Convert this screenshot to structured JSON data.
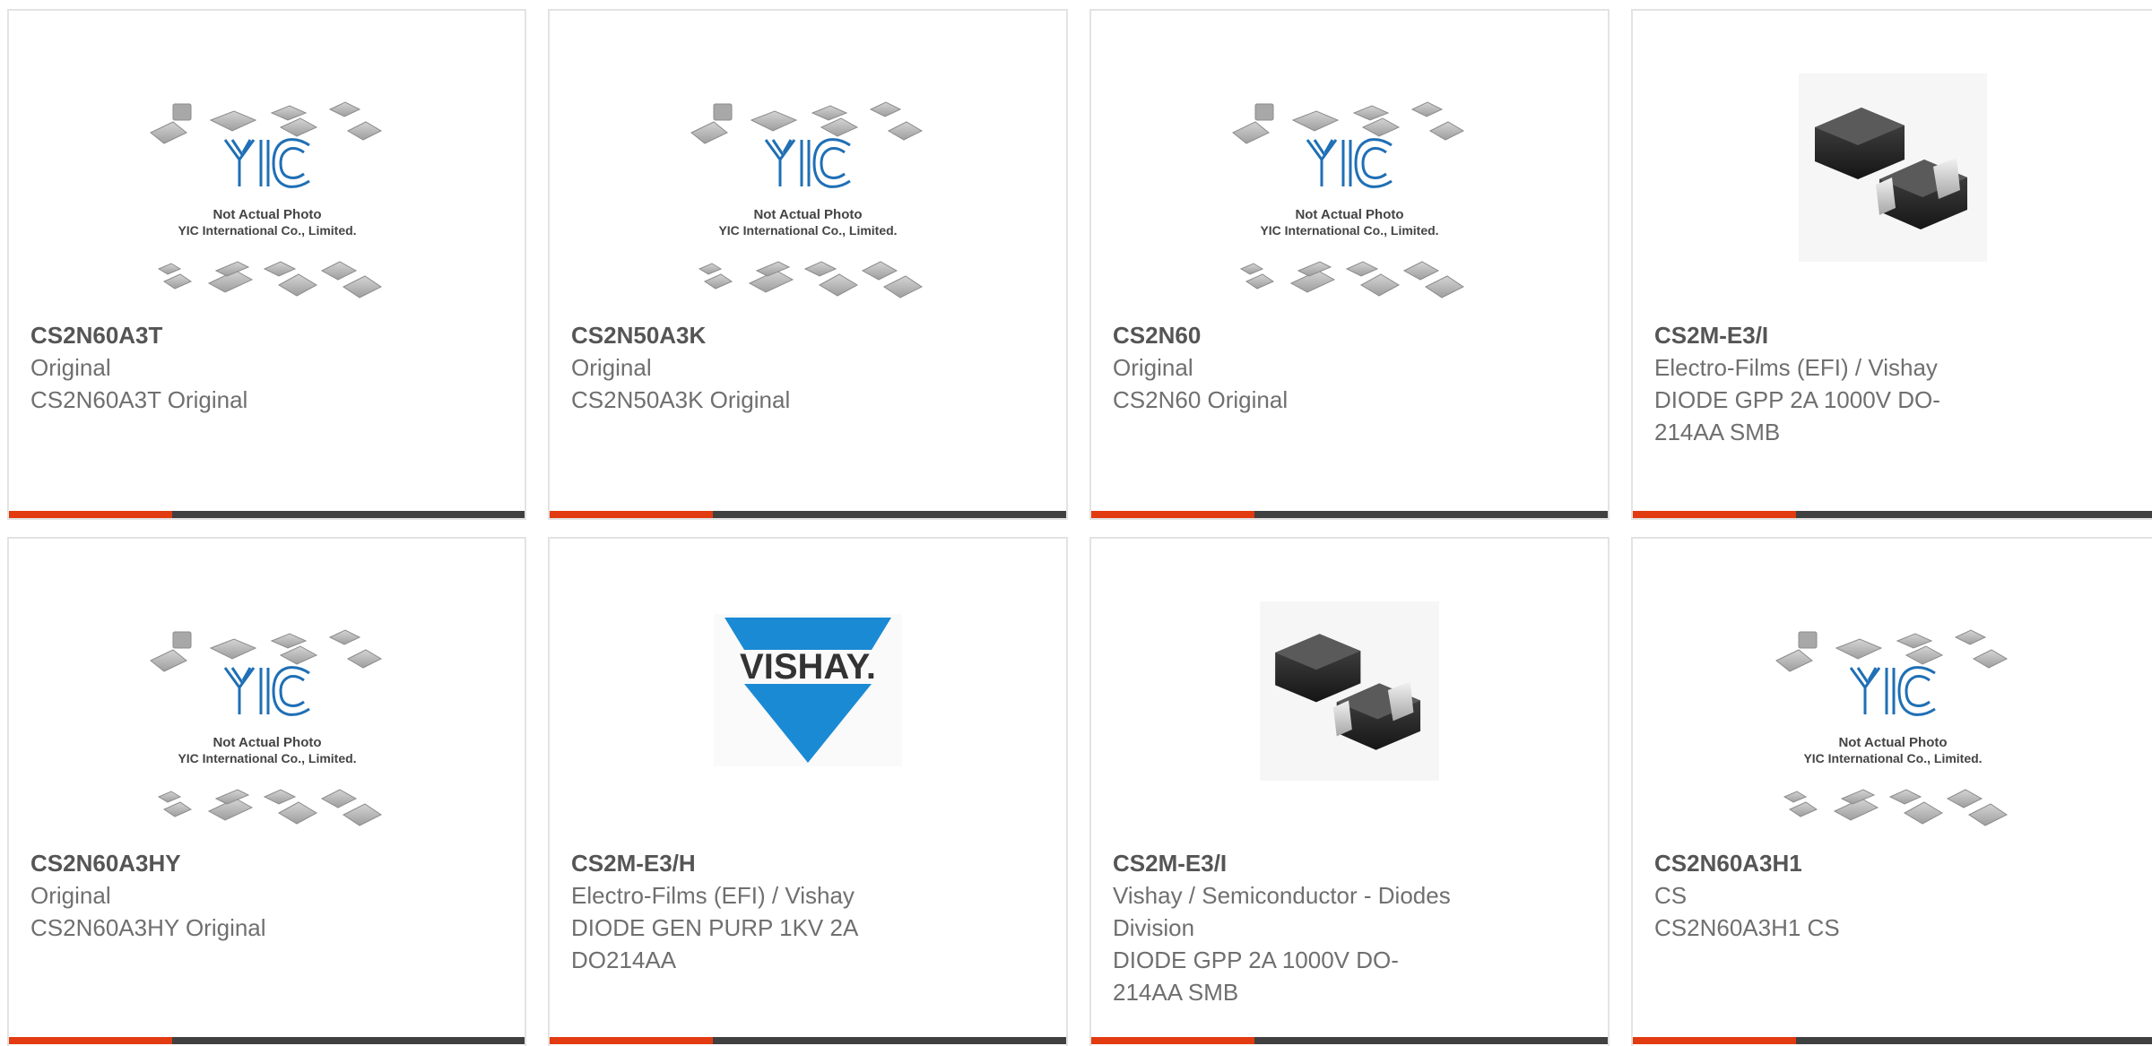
{
  "accent_color": "#e23b11",
  "bar_color": "#404040",
  "placeholder_image": {
    "logo_text": "YIC",
    "line1": "Not Actual Photo",
    "line2": "YIC International Co., Limited."
  },
  "vishay_logo_text": "VISHAY.",
  "cards": [
    {
      "part_number": "CS2N60A3T",
      "manufacturer": "Original",
      "description": "CS2N60A3T Original",
      "image": "yic-placeholder"
    },
    {
      "part_number": "CS2N50A3K",
      "manufacturer": "Original",
      "description": "CS2N50A3K Original",
      "image": "yic-placeholder"
    },
    {
      "part_number": "CS2N60",
      "manufacturer": "Original",
      "description": "CS2N60 Original",
      "image": "yic-placeholder"
    },
    {
      "part_number": "CS2M-E3/I",
      "manufacturer": "Electro-Films (EFI) / Vishay",
      "description": "DIODE GPP 2A 1000V DO-214AA SMB",
      "image": "smb-diode-photo"
    },
    {
      "part_number": "CS2N60A3HY",
      "manufacturer": "Original",
      "description": "CS2N60A3HY Original",
      "image": "yic-placeholder"
    },
    {
      "part_number": "CS2M-E3/H",
      "manufacturer": "Electro-Films (EFI) / Vishay",
      "description": "DIODE GEN PURP 1KV 2A DO214AA",
      "image": "vishay-logo"
    },
    {
      "part_number": "CS2M-E3/I",
      "manufacturer": "Vishay / Semiconductor - Diodes Division",
      "description": "DIODE GPP 2A 1000V DO-214AA SMB",
      "image": "smb-diode-photo"
    },
    {
      "part_number": "CS2N60A3H1",
      "manufacturer": "CS",
      "description": "CS2N60A3H1 CS",
      "image": "yic-placeholder"
    }
  ]
}
